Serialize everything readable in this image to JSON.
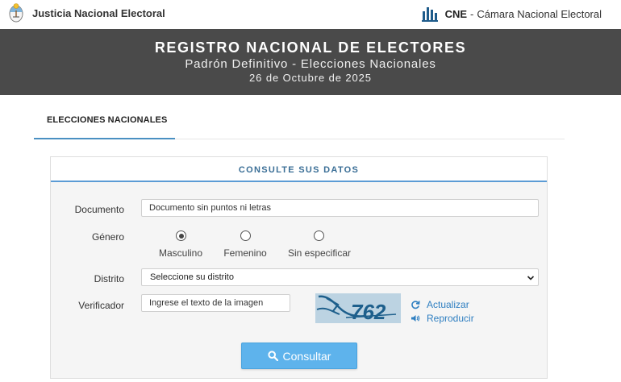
{
  "header": {
    "left_title": "Justicia Nacional Electoral",
    "right_acronym": "CNE",
    "right_separator": "-",
    "right_title": "Cámara Nacional Electoral"
  },
  "banner": {
    "title": "REGISTRO NACIONAL DE ELECTORES",
    "subtitle": "Padrón Definitivo - Elecciones Nacionales",
    "date": "26 de Octubre de 2025"
  },
  "tabs": [
    {
      "label": "ELECCIONES NACIONALES",
      "active": true
    }
  ],
  "form": {
    "heading": "CONSULTE SUS DATOS",
    "documento": {
      "label": "Documento",
      "placeholder": "Documento sin puntos ni letras"
    },
    "genero": {
      "label": "Género",
      "options": [
        {
          "label": "Masculino",
          "selected": true
        },
        {
          "label": "Femenino",
          "selected": false
        },
        {
          "label": "Sin especificar",
          "selected": false
        }
      ]
    },
    "distrito": {
      "label": "Distrito",
      "selected": "Seleccione su distrito"
    },
    "verificador": {
      "label": "Verificador",
      "placeholder": "Ingrese el texto de la imagen",
      "captcha_text": "762",
      "refresh_label": "Actualizar",
      "audio_label": "Reproducir"
    },
    "submit_label": "Consultar"
  },
  "colors": {
    "banner_bg": "#4a4a4a",
    "accent": "#5b9bd5",
    "button": "#5eb3ec",
    "link": "#2f7fc1"
  }
}
